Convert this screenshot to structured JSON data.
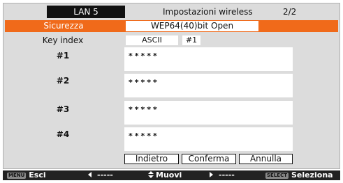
{
  "header": {
    "lan": "LAN 5",
    "title": "Impostazioni wireless",
    "page": "2/2"
  },
  "security": {
    "label": "Sicurezza",
    "value": "WEP64(40)bit Open"
  },
  "key_index": {
    "label": "Key index",
    "mode": "ASCII",
    "index": "#1"
  },
  "keys": [
    {
      "label": "#1",
      "value": "*****"
    },
    {
      "label": "#2",
      "value": "*****"
    },
    {
      "label": "#3",
      "value": "*****"
    },
    {
      "label": "#4",
      "value": "*****"
    }
  ],
  "buttons": {
    "back": "Indietro",
    "confirm": "Conferma",
    "cancel": "Annulla"
  },
  "status_bar": {
    "menu_tag": "MENU",
    "exit": "Esci",
    "left_value": "-----",
    "move": "Muovi",
    "right_value": "-----",
    "select_tag": "SELECT",
    "select": "Seleziona"
  },
  "colors": {
    "highlight": "#f06a1a",
    "panel": "#dcdcdc",
    "status_bar": "#222222"
  },
  "icons": {
    "left": "arrow-left-icon",
    "updown": "updown-arrows-icon",
    "right": "arrow-right-icon"
  }
}
